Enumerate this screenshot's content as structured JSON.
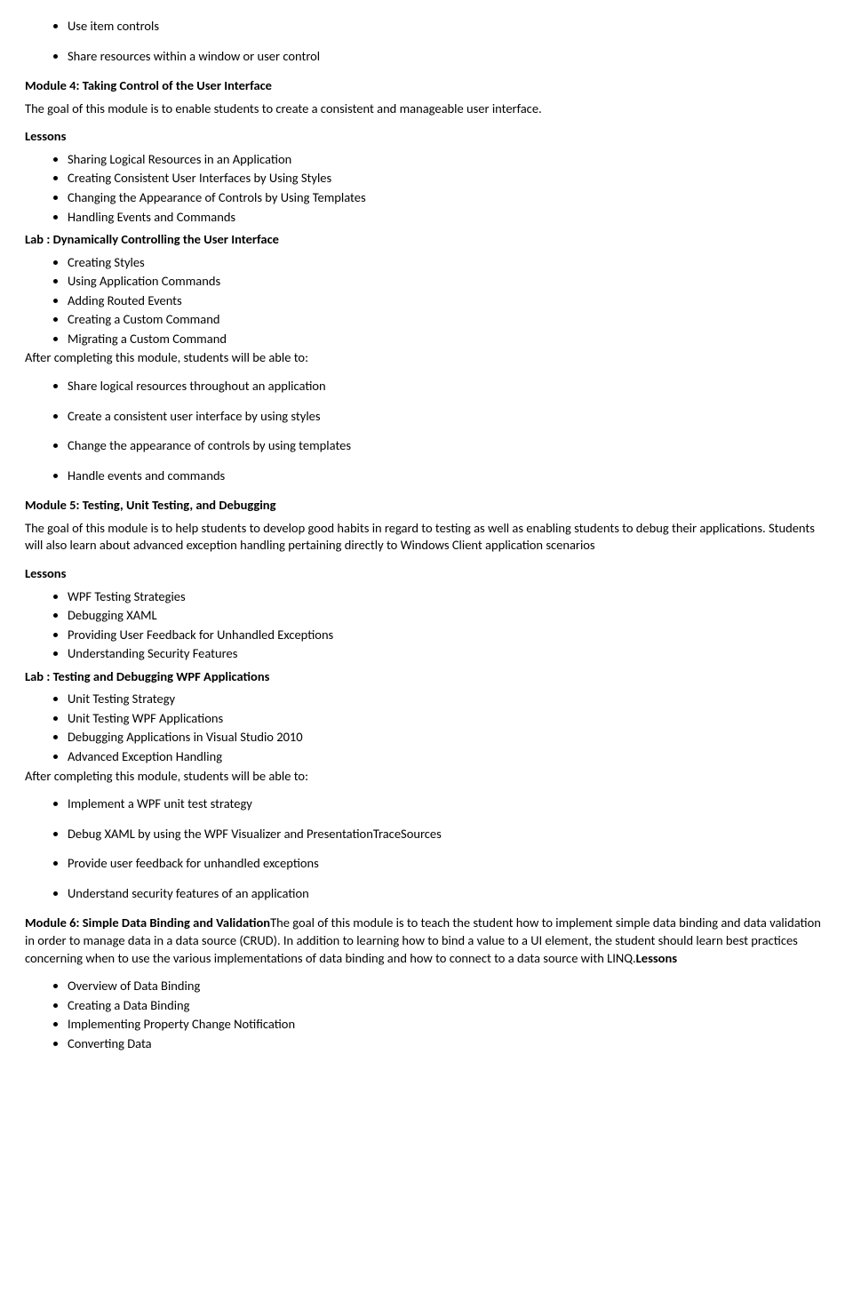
{
  "prevModule": {
    "trailingBullets": [
      "Use item controls",
      "Share resources within a window or user control"
    ]
  },
  "module4": {
    "title": "Module 4: Taking Control of the User Interface",
    "goal": "The goal of this module is to enable students to create a consistent and manageable user interface.",
    "lessonsLabel": "Lessons",
    "lessons": [
      "Sharing Logical Resources in an Application",
      "Creating Consistent User Interfaces by Using Styles",
      "Changing the Appearance of Controls by Using Templates",
      "Handling Events and Commands"
    ],
    "labLabel": "Lab : Dynamically Controlling the User Interface",
    "labItems": [
      "Creating Styles",
      "Using Application Commands",
      "Adding Routed Events",
      "Creating a Custom Command",
      "Migrating a Custom Command"
    ],
    "afterLabel": "After completing this module, students will be able to:",
    "outcomes": [
      "Share logical resources throughout an application",
      "Create a consistent user interface by using styles",
      "Change the appearance of controls by using templates",
      "Handle events and commands"
    ]
  },
  "module5": {
    "title": "Module 5: Testing, Unit Testing, and Debugging",
    "goal": "The goal of this module is to help students to develop good habits in regard to testing as well as enabling students to debug their applications. Students will also learn about advanced exception handling pertaining directly to Windows Client application scenarios",
    "lessonsLabel": "Lessons",
    "lessons": [
      "WPF Testing Strategies",
      "Debugging XAML",
      "Providing User Feedback for Unhandled Exceptions",
      "Understanding Security Features"
    ],
    "labLabel": "Lab : Testing and Debugging WPF Applications",
    "labItems": [
      "Unit Testing Strategy",
      "Unit Testing WPF Applications",
      "Debugging Applications in Visual Studio 2010",
      "Advanced Exception Handling"
    ],
    "afterLabel": "After completing this module, students will be able to:",
    "outcomes": [
      "Implement a WPF unit test strategy",
      "Debug XAML by using the WPF Visualizer and PresentationTraceSources",
      "Provide user feedback for unhandled exceptions",
      "Understand security features of an application"
    ]
  },
  "module6": {
    "title": "Module 6: Simple Data Binding and Validation",
    "goal": "The goal of this module is to teach the student how to implement simple data binding and data validation in order to manage data in a data source (CRUD). In addition to learning how to bind a value to a UI element, the student should learn best practices concerning when to use the various implementations of data binding and how to connect to a data source with LINQ.",
    "lessonsLabel": "Lessons",
    "lessons": [
      "Overview of Data Binding",
      "Creating a Data Binding",
      "Implementing Property Change Notification",
      "Converting Data"
    ]
  }
}
